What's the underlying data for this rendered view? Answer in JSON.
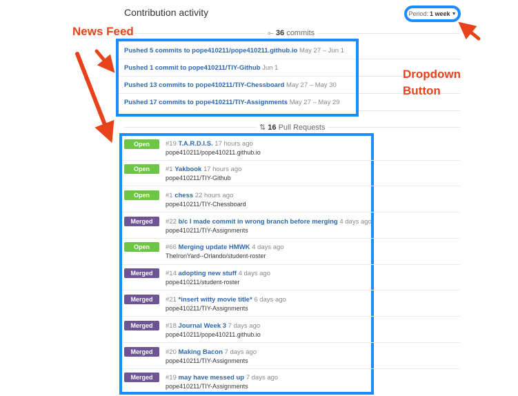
{
  "header": {
    "title": "Contribution activity",
    "period_label": "Period:",
    "period_value": "1 week"
  },
  "commits_sep": {
    "count": "36",
    "label": "commits"
  },
  "pr_sep": {
    "count": "16",
    "label": "Pull Requests"
  },
  "annotations": {
    "news_feed": "News Feed",
    "dropdown_line1": "Dropdown",
    "dropdown_line2": "Button"
  },
  "feed": [
    {
      "text": "Pushed 5 commits to pope410211/pope410211.github.io",
      "date": "May 27 – Jun 1"
    },
    {
      "text": "Pushed 1 commit to pope410211/TIY-Github",
      "date": "Jun 1"
    },
    {
      "text": "Pushed 13 commits to pope410211/TIY-Chessboard",
      "date": "May 27 – May 30"
    },
    {
      "text": "Pushed 17 commits to pope410211/TIY-Assignments",
      "date": "May 27 – May 29"
    }
  ],
  "pull_requests": [
    {
      "status": "Open",
      "number": "#19",
      "title": "T.A.R.D.I.S.",
      "time": "17 hours ago",
      "repo": "pope410211/pope410211.github.io"
    },
    {
      "status": "Open",
      "number": "#1",
      "title": "Yakbook",
      "time": "17 hours ago",
      "repo": "pope410211/TIY-Github"
    },
    {
      "status": "Open",
      "number": "#1",
      "title": "chess",
      "time": "22 hours ago",
      "repo": "pope410211/TIY-Chessboard"
    },
    {
      "status": "Merged",
      "number": "#22",
      "title": "b/c I made commit in wrong branch before merging",
      "time": "4 days ago",
      "repo": "pope410211/TIY-Assignments"
    },
    {
      "status": "Open",
      "number": "#66",
      "title": "Merging update HMWK",
      "time": "4 days ago",
      "repo": "TheIronYard--Orlando/student-roster"
    },
    {
      "status": "Merged",
      "number": "#14",
      "title": "adopting new stuff",
      "time": "4 days ago",
      "repo": "pope410211/student-roster"
    },
    {
      "status": "Merged",
      "number": "#21",
      "title": "*insert witty movie title*",
      "time": "6 days ago",
      "repo": "pope410211/TIY-Assignments"
    },
    {
      "status": "Merged",
      "number": "#18",
      "title": "Journal Week 3",
      "time": "7 days ago",
      "repo": "pope410211/pope410211.github.io"
    },
    {
      "status": "Merged",
      "number": "#20",
      "title": "Making Bacon",
      "time": "7 days ago",
      "repo": "pope410211/TIY-Assignments"
    },
    {
      "status": "Merged",
      "number": "#19",
      "title": "may have messed up",
      "time": "7 days ago",
      "repo": "pope410211/TIY-Assignments"
    }
  ],
  "colors": {
    "accent": "#1a8cff",
    "open": "#6cc644",
    "merged": "#6e5494",
    "link": "#2d67b0",
    "callout": "#e8421a"
  }
}
